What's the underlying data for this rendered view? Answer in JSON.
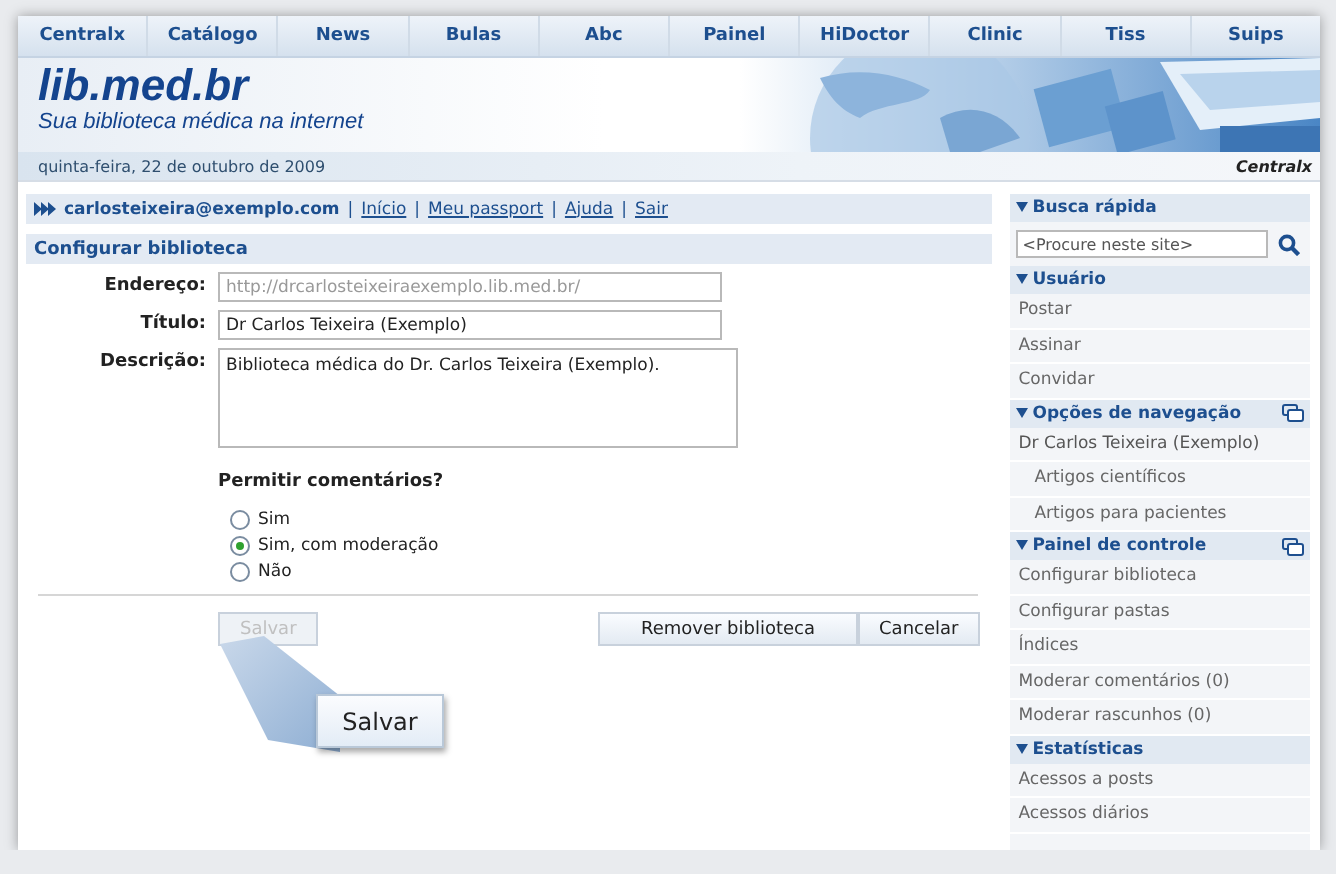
{
  "nav": [
    {
      "label": "Centralx"
    },
    {
      "label": "Catálogo"
    },
    {
      "label": "News"
    },
    {
      "label": "Bulas"
    },
    {
      "label": "Abc"
    },
    {
      "label": "Painel"
    },
    {
      "label": "HiDoctor"
    },
    {
      "label": "Clinic"
    },
    {
      "label": "Tiss"
    },
    {
      "label": "Suips"
    }
  ],
  "header": {
    "logo": "lib.med.br",
    "tagline": "Sua biblioteca médica na internet"
  },
  "date_bar": {
    "date": "quinta-feira, 22 de outubro de 2009",
    "brand": "Centralx"
  },
  "user_bar": {
    "user": "carlosteixeira@exemplo.com",
    "separator": "|",
    "links": [
      "Início",
      "Meu passport",
      "Ajuda",
      "Sair"
    ]
  },
  "form": {
    "title": "Configurar biblioteca",
    "fields": [
      {
        "label": "Endereço:",
        "kind": "input",
        "value": "http://drcarlosteixeiraexemplo.lib.med.br/",
        "disabled": true
      },
      {
        "label": "Título:",
        "kind": "input",
        "value": "Dr Carlos Teixeira (Exemplo)",
        "disabled": false
      },
      {
        "label": "Descrição:",
        "kind": "textarea",
        "value": "Biblioteca médica do Dr. Carlos Teixeira (Exemplo).",
        "disabled": false
      }
    ],
    "comments_question": "Permitir comentários?",
    "comment_options": [
      {
        "label": "Sim",
        "selected": false
      },
      {
        "label": "Sim, com moderação",
        "selected": true
      },
      {
        "label": "Não",
        "selected": false
      }
    ],
    "save_button": {
      "label": "Salvar",
      "disabled": true
    },
    "buttons": [
      {
        "label": "Remover biblioteca",
        "disabled": false
      },
      {
        "label": "Cancelar",
        "disabled": false
      }
    ],
    "callout": {
      "label": "Salvar"
    }
  },
  "sidebar": [
    {
      "title": "Busca rápida",
      "kind": "search",
      "has_window_icon": false,
      "placeholder": "<Procure neste site>"
    },
    {
      "title": "Usuário",
      "kind": "links",
      "has_window_icon": false,
      "items": [
        {
          "label": "Postar"
        },
        {
          "label": "Assinar"
        },
        {
          "label": "Convidar"
        }
      ]
    },
    {
      "title": "Opções de navegação",
      "kind": "links",
      "has_window_icon": true,
      "items": [
        {
          "label": "Dr Carlos Teixeira (Exemplo)",
          "children": [
            {
              "label": "Artigos científicos"
            },
            {
              "label": "Artigos para pacientes"
            }
          ]
        }
      ]
    },
    {
      "title": "Painel de controle",
      "kind": "links",
      "has_window_icon": true,
      "items": [
        {
          "label": "Configurar biblioteca"
        },
        {
          "label": "Configurar pastas"
        },
        {
          "label": "Índices"
        },
        {
          "label": "Moderar comentários (0)"
        },
        {
          "label": "Moderar rascunhos (0)"
        }
      ]
    },
    {
      "title": "Estatísticas",
      "kind": "links",
      "has_window_icon": false,
      "items": [
        {
          "label": "Acessos a posts"
        },
        {
          "label": "Acessos diários"
        }
      ]
    }
  ]
}
